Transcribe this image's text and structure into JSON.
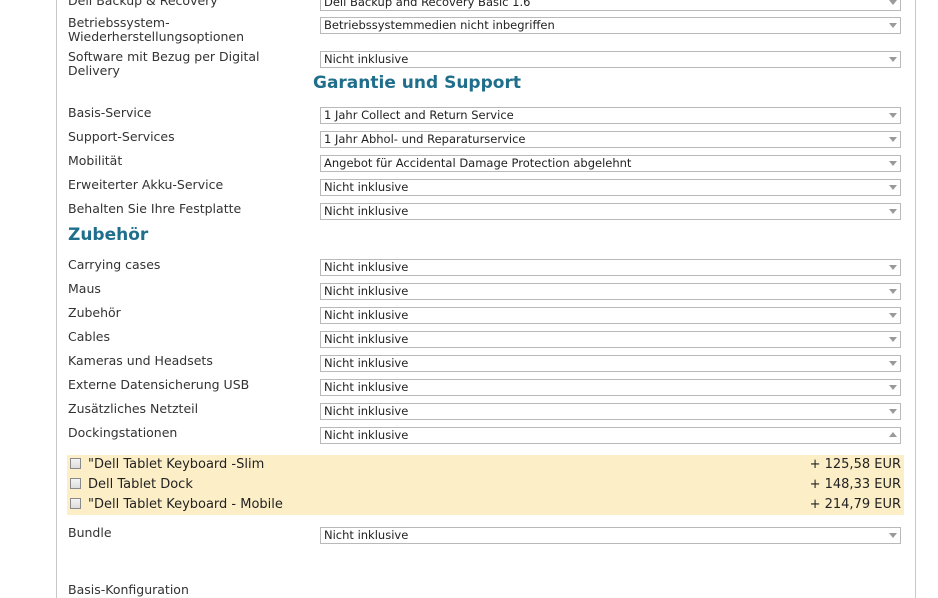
{
  "rows_top": [
    {
      "label": "Dell Backup & Recovery",
      "value": "Dell Backup and Recovery Basic 1.6"
    },
    {
      "label": "Betriebssystem-\nWiederherstellungsoptionen",
      "value": "Betriebssystemmedien nicht inbegriffen"
    },
    {
      "label": "Software mit Bezug per Digital\nDelivery",
      "value": "Nicht inklusive"
    }
  ],
  "garantie": {
    "heading": "Garantie und Support",
    "rows": [
      {
        "label": "Basis-Service",
        "value": "1 Jahr Collect and Return Service"
      },
      {
        "label": "Support-Services",
        "value": "1 Jahr Abhol- und Reparaturservice"
      },
      {
        "label": "Mobilität",
        "value": "Angebot für Accidental Damage Protection abgelehnt"
      },
      {
        "label": "Erweiterter Akku-Service",
        "value": "Nicht inklusive"
      },
      {
        "label": "Behalten Sie Ihre Festplatte",
        "value": "Nicht inklusive"
      }
    ]
  },
  "zubehoer": {
    "heading": "Zubehör",
    "rows": [
      {
        "label": "Carrying cases",
        "value": "Nicht inklusive"
      },
      {
        "label": "Maus",
        "value": "Nicht inklusive"
      },
      {
        "label": "Zubehör",
        "value": "Nicht inklusive"
      },
      {
        "label": "Cables",
        "value": "Nicht inklusive"
      },
      {
        "label": "Kameras und Headsets",
        "value": "Nicht inklusive"
      },
      {
        "label": "Externe Datensicherung USB",
        "value": "Nicht inklusive"
      },
      {
        "label": "Zusätzliches Netzteil",
        "value": "Nicht inklusive"
      },
      {
        "label": "Dockingstationen",
        "value": "Nicht inklusive"
      }
    ],
    "docking_options": [
      {
        "name": "\"Dell Tablet Keyboard -Slim",
        "price": "+ 125,58 EUR",
        "checked": false
      },
      {
        "name": "Dell Tablet Dock",
        "price": "+ 148,33 EUR",
        "checked": false
      },
      {
        "name": "\"Dell Tablet Keyboard - Mobile",
        "price": "+ 214,79 EUR",
        "checked": false
      }
    ],
    "bundle": {
      "label": "Bundle",
      "value": "Nicht inklusive"
    }
  },
  "footer_label": "Basis-Konfiguration",
  "colors": {
    "heading": "#1f6e8c",
    "highlight": "#fcefc8"
  },
  "icons": {
    "dropdown": "chevron-down-icon",
    "dropdown_open": "chevron-up-icon"
  }
}
